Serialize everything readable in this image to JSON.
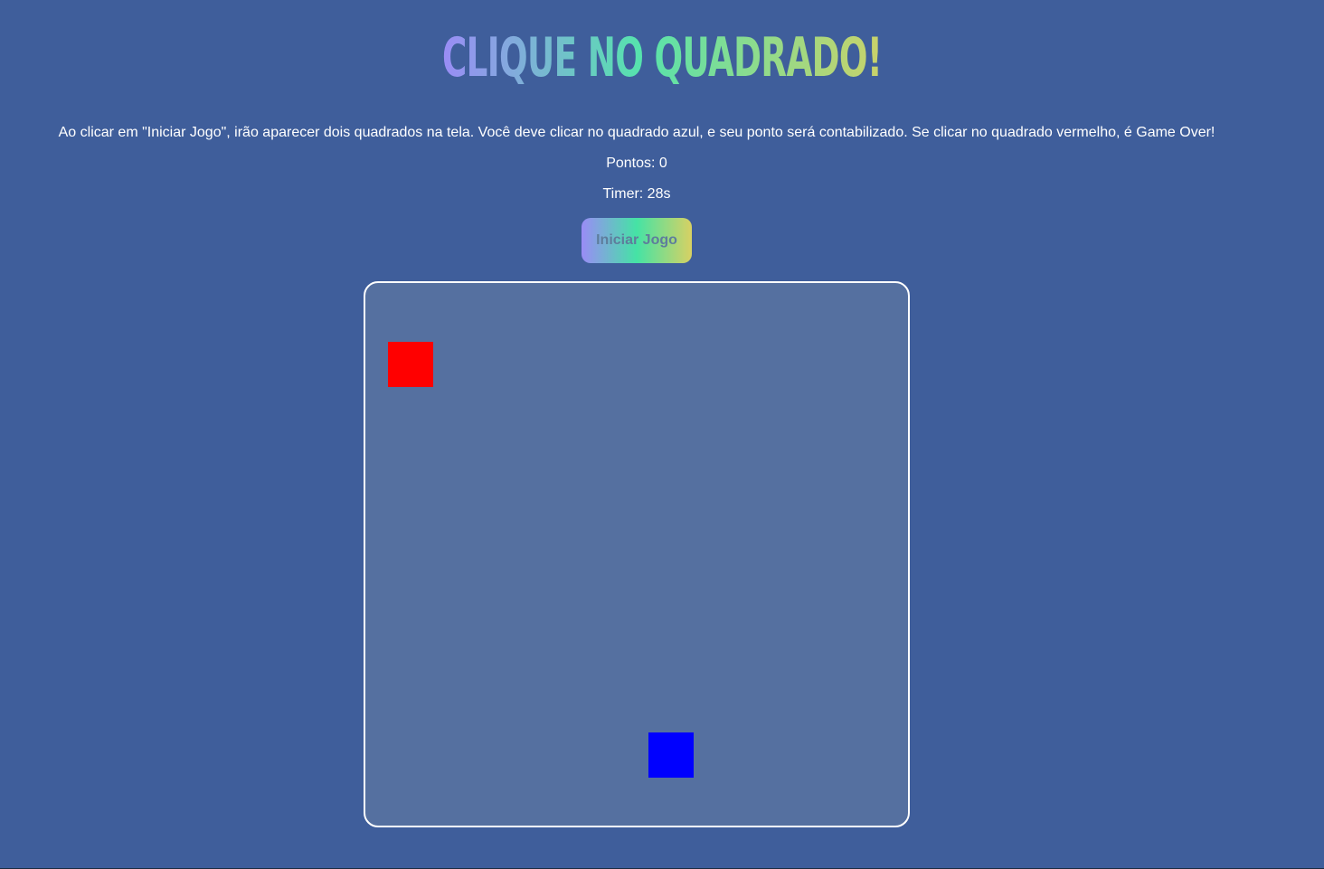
{
  "header": {
    "title": "CLIQUE NO QUADRADO!"
  },
  "instructions": {
    "text": "Ao clicar em \"Iniciar Jogo\", irão aparecer dois quadrados na tela. Você deve clicar no quadrado azul, e seu ponto será contabilizado. Se clicar no quadrado vermelho, é Game Over!"
  },
  "score": {
    "label": "Pontos: 0",
    "value": 0
  },
  "timer": {
    "label": "Timer: 28s",
    "seconds": 28
  },
  "controls": {
    "start_label": "Iniciar Jogo"
  },
  "game": {
    "squares": [
      {
        "color_name": "vermelho",
        "color": "#ff0000"
      },
      {
        "color_name": "azul",
        "color": "#0000ff"
      }
    ]
  },
  "colors": {
    "background": "#3f5e9b",
    "game_area": "#5570a0",
    "accent_gradient": [
      "#9a8cf6",
      "#45e3a5",
      "#d8d163"
    ]
  }
}
